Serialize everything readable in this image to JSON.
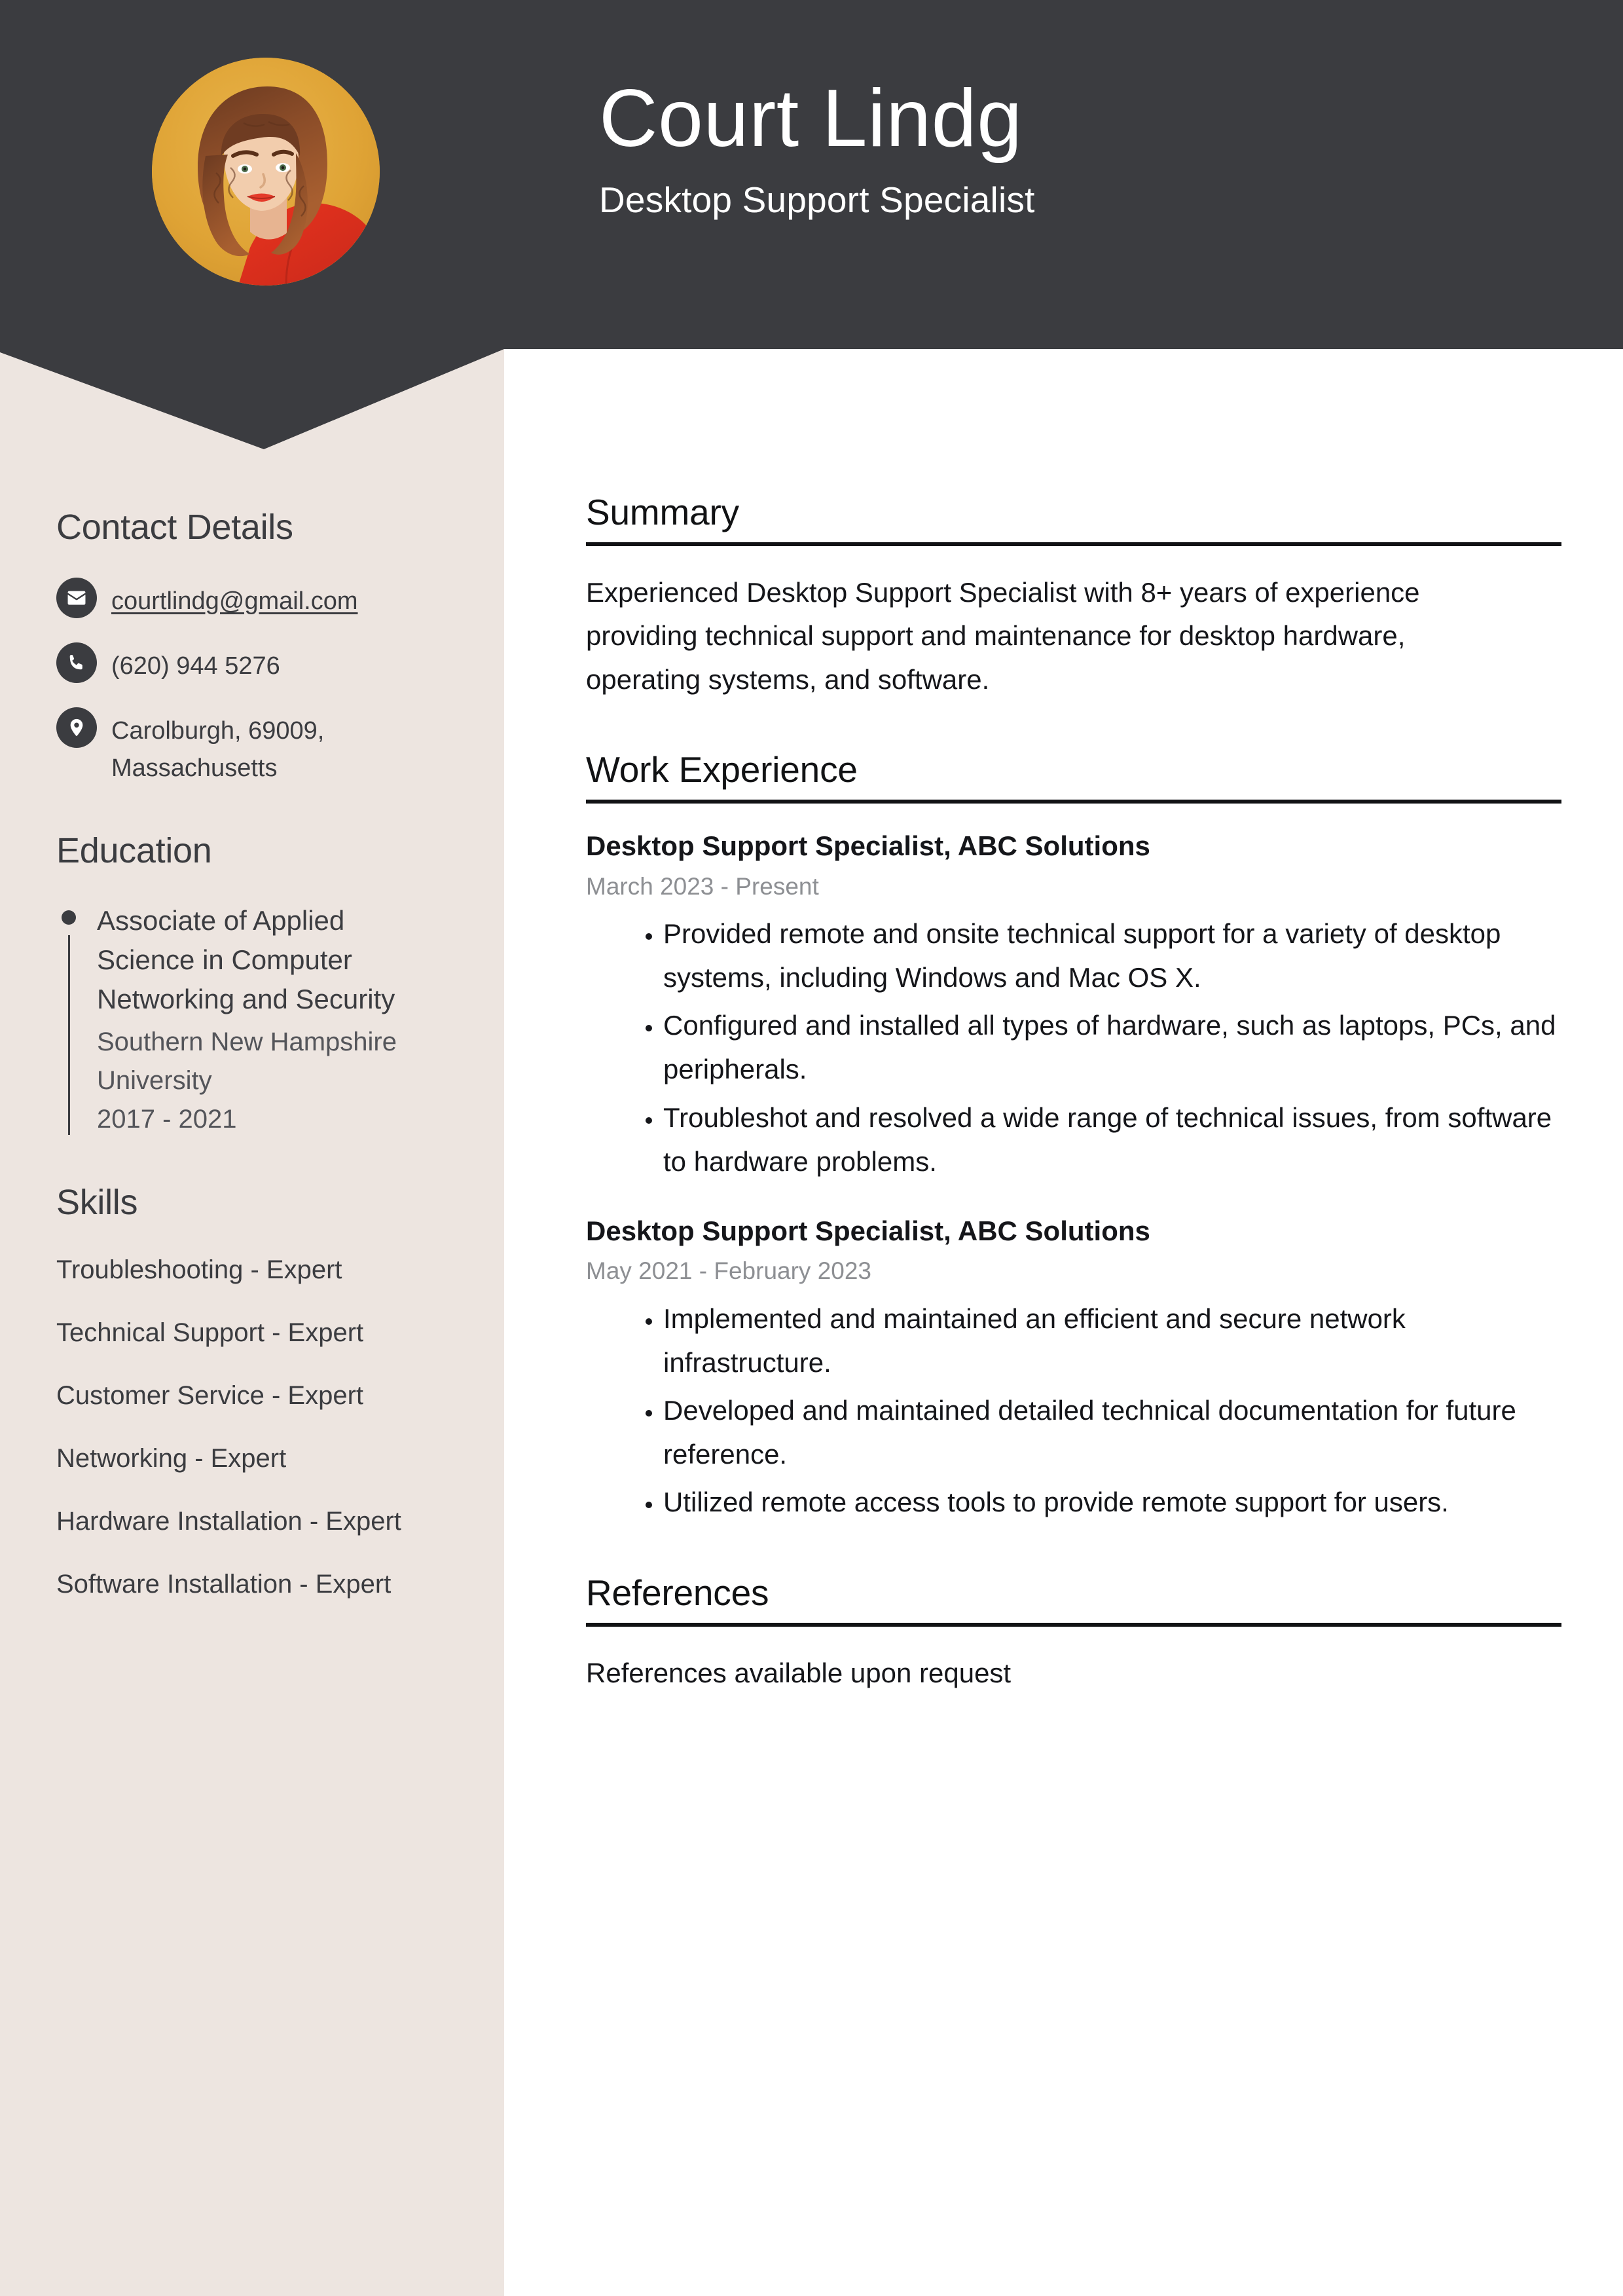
{
  "colors": {
    "header_dark": "#3b3c40",
    "sidebar_beige": "#ede5e0",
    "page_white": "#ffffff",
    "avatar_backdrop": "#e0a537",
    "muted_text": "#8d8f93"
  },
  "header": {
    "name": "Court Lindg",
    "job_title": "Desktop Support Specialist",
    "avatar_alt": "profile-photo"
  },
  "sidebar": {
    "contact": {
      "heading": "Contact Details",
      "items": [
        {
          "icon": "envelope-icon",
          "value": "courtlindg@gmail.com",
          "is_link": true
        },
        {
          "icon": "phone-icon",
          "value": "(620) 944 5276",
          "is_link": false
        },
        {
          "icon": "location-pin-icon",
          "value": "Carolburgh, 69009, Massachusetts",
          "is_link": false
        }
      ]
    },
    "education": {
      "heading": "Education",
      "items": [
        {
          "degree": "Associate of Applied Science in Computer Networking and Security",
          "school": "Southern New Hampshire University",
          "dates": "2017 - 2021"
        }
      ]
    },
    "skills": {
      "heading": "Skills",
      "items": [
        "Troubleshooting - Expert",
        "Technical Support - Expert",
        "Customer Service - Expert",
        "Networking - Expert",
        "Hardware Installation - Expert",
        "Software Installation - Expert"
      ]
    }
  },
  "main": {
    "summary": {
      "heading": "Summary",
      "text": "Experienced Desktop Support Specialist with 8+ years of experience providing technical support and maintenance for desktop hardware, operating systems, and software."
    },
    "work_experience": {
      "heading": "Work Experience",
      "jobs": [
        {
          "role": "Desktop Support Specialist, ABC Solutions",
          "dates": "March 2023 - Present",
          "bullets": [
            "Provided remote and onsite technical support for a variety of desktop systems, including Windows and Mac OS X.",
            "Configured and installed all types of hardware, such as laptops, PCs, and peripherals.",
            "Troubleshot and resolved a wide range of technical issues, from software to hardware problems."
          ]
        },
        {
          "role": "Desktop Support Specialist, ABC Solutions",
          "dates": "May 2021 - February 2023",
          "bullets": [
            "Implemented and maintained an efficient and secure network infrastructure.",
            "Developed and maintained detailed technical documentation for future reference.",
            "Utilized remote access tools to provide remote support for users."
          ]
        }
      ]
    },
    "references": {
      "heading": "References",
      "text": "References available upon request"
    }
  }
}
